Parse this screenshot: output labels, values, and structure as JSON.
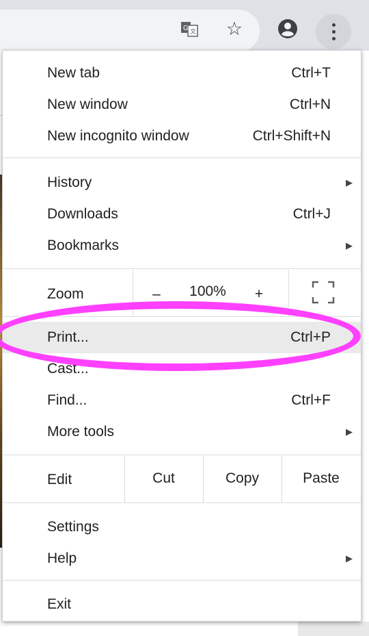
{
  "browser": {
    "icons": [
      "translate-icon",
      "star-icon",
      "profile-icon",
      "more-options-icon"
    ]
  },
  "menu": {
    "group1": [
      {
        "label": "New tab",
        "shortcut": "Ctrl+T"
      },
      {
        "label": "New window",
        "shortcut": "Ctrl+N"
      },
      {
        "label": "New incognito window",
        "shortcut": "Ctrl+Shift+N"
      }
    ],
    "group2": [
      {
        "label": "History",
        "shortcut": ""
      },
      {
        "label": "Downloads",
        "shortcut": "Ctrl+J"
      },
      {
        "label": "Bookmarks",
        "shortcut": ""
      }
    ],
    "zoom": {
      "label": "Zoom",
      "minus": "–",
      "value": "100%",
      "plus": "+"
    },
    "group3": [
      {
        "label": "Print...",
        "shortcut": "Ctrl+P"
      },
      {
        "label": "Cast...",
        "shortcut": ""
      },
      {
        "label": "Find...",
        "shortcut": "Ctrl+F"
      },
      {
        "label": "More tools",
        "shortcut": ""
      }
    ],
    "edit": {
      "label": "Edit",
      "cut": "Cut",
      "copy": "Copy",
      "paste": "Paste"
    },
    "group4": [
      {
        "label": "Settings"
      },
      {
        "label": "Help"
      }
    ],
    "exit": {
      "label": "Exit"
    },
    "highlight_color": "#ff40ff"
  }
}
